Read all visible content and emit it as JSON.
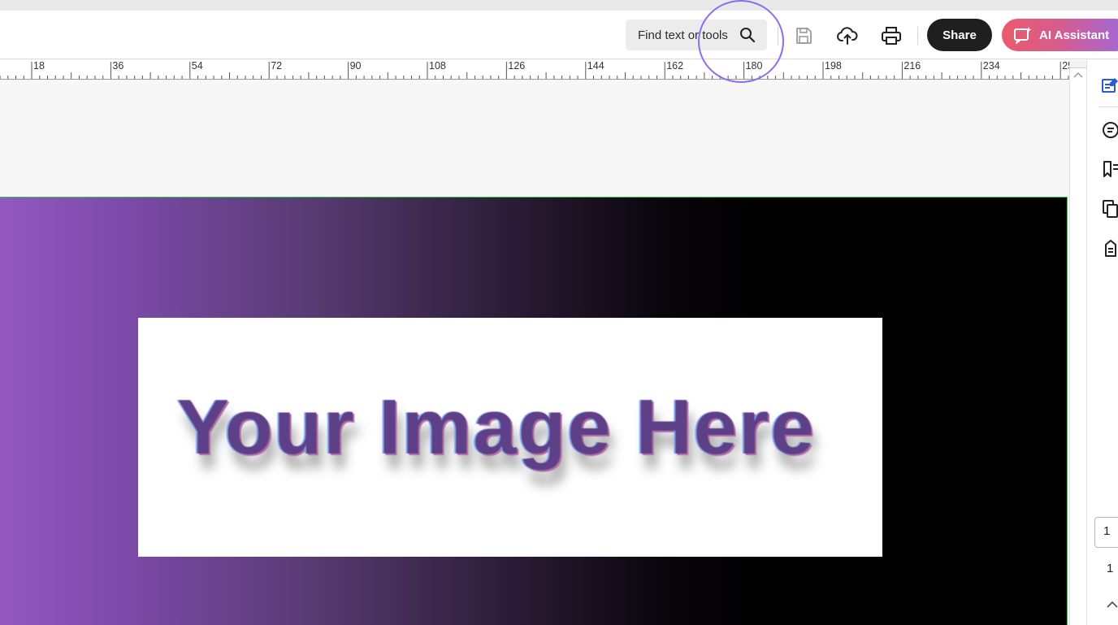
{
  "toolbar": {
    "search_placeholder": "Find text or tools",
    "share_label": "Share",
    "ai_assistant_label": "AI Assistant"
  },
  "ruler": {
    "labels": [
      "18",
      "36",
      "54",
      "72",
      "90",
      "108",
      "126",
      "144",
      "162",
      "180",
      "198",
      "216",
      "234",
      "25"
    ]
  },
  "document": {
    "image_text": "Your Image Here"
  },
  "page_nav": {
    "current_page": "1",
    "total_pages": "1"
  },
  "colors": {
    "accent_ring": "#8e6cf0",
    "share_bg": "#1f1f1f",
    "page_border": "#2ecc40"
  }
}
